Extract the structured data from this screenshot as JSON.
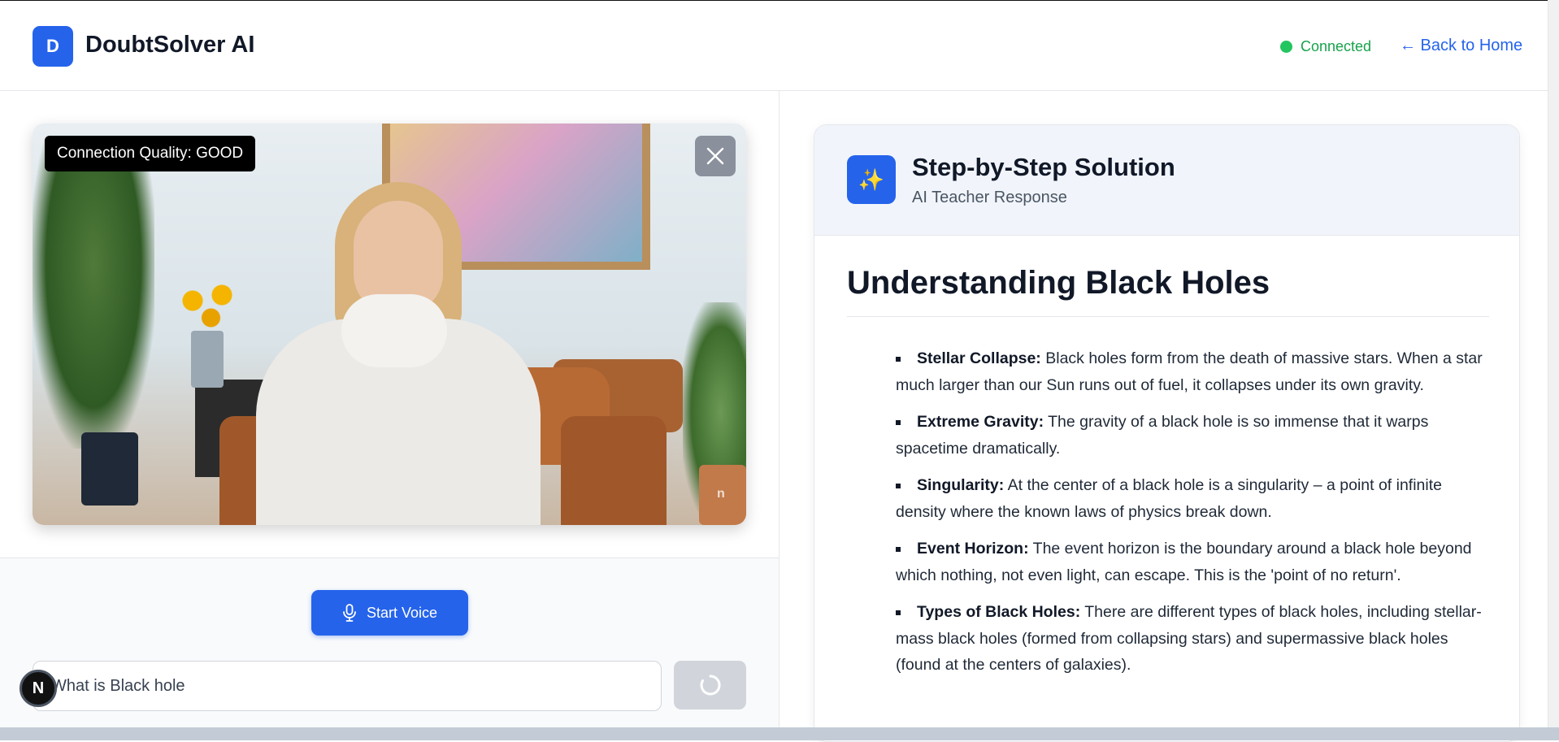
{
  "header": {
    "logo_letter": "D",
    "app_title": "DoubtSolver AI",
    "status": "Connected",
    "back_link": "← Back to Home"
  },
  "video": {
    "quality_badge": "Connection Quality: GOOD",
    "watermark": "n"
  },
  "controls": {
    "voice_button": "Start Voice",
    "query_value": "What is Black hole",
    "floating_badge": "N"
  },
  "solution": {
    "icon": "sparkles-icon",
    "title": "Step-by-Step Solution",
    "subtitle": "AI Teacher Response",
    "article_title": "Understanding Black Holes",
    "points": [
      {
        "term": "Stellar Collapse:",
        "text": " Black holes form from the death of massive stars. When a star much larger than our Sun runs out of fuel, it collapses under its own gravity."
      },
      {
        "term": "Extreme Gravity:",
        "text": " The gravity of a black hole is so immense that it warps spacetime dramatically."
      },
      {
        "term": "Singularity:",
        "text": " At the center of a black hole is a singularity – a point of infinite density where the known laws of physics break down."
      },
      {
        "term": "Event Horizon:",
        "text": " The event horizon is the boundary around a black hole beyond which nothing, not even light, can escape. This is the 'point of no return'."
      },
      {
        "term": "Types of Black Holes:",
        "text": " There are different types of black holes, including stellar-mass black holes (formed from collapsing stars) and supermassive black holes (found at the centers of galaxies)."
      }
    ]
  },
  "colors": {
    "accent": "#2563eb",
    "status_green": "#22c55e"
  }
}
